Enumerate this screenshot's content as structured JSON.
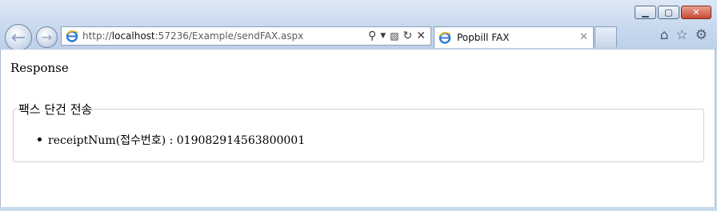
{
  "browser": {
    "address": {
      "protocol": "http://",
      "host": "localhost",
      "rest": ":57236/Example/sendFAX.aspx"
    },
    "tab": {
      "title": "Popbill FAX"
    }
  },
  "page": {
    "heading": "Response",
    "fieldset": {
      "legend": "팩스 단건 전송",
      "items": [
        {
          "text": "receiptNum(접수번호) : 019082914563800001"
        }
      ]
    }
  }
}
